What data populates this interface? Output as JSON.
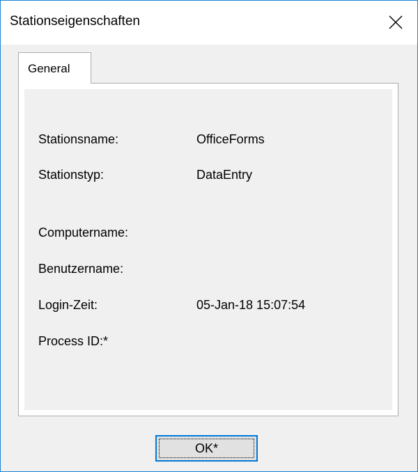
{
  "window": {
    "title": "Stationseigenschaften",
    "close_glyph": "close-icon"
  },
  "tabs": [
    {
      "label": "General",
      "selected": true
    }
  ],
  "properties": [
    {
      "label": "Stationsname:",
      "value": "OfficeForms"
    },
    {
      "label": "Stationstyp:",
      "value": "DataEntry"
    },
    {
      "label": "Computername:",
      "value": ""
    },
    {
      "label": "Benutzername:",
      "value": ""
    },
    {
      "label": "Login-Zeit:",
      "value": "05-Jan-18 15:07:54"
    },
    {
      "label": "Process ID:*",
      "value": ""
    }
  ],
  "buttons": {
    "ok_label": "OK*"
  },
  "colors": {
    "window_border": "#1883d7",
    "dialog_background": "#f0f0f0",
    "button_focus_border": "#0078d7"
  }
}
